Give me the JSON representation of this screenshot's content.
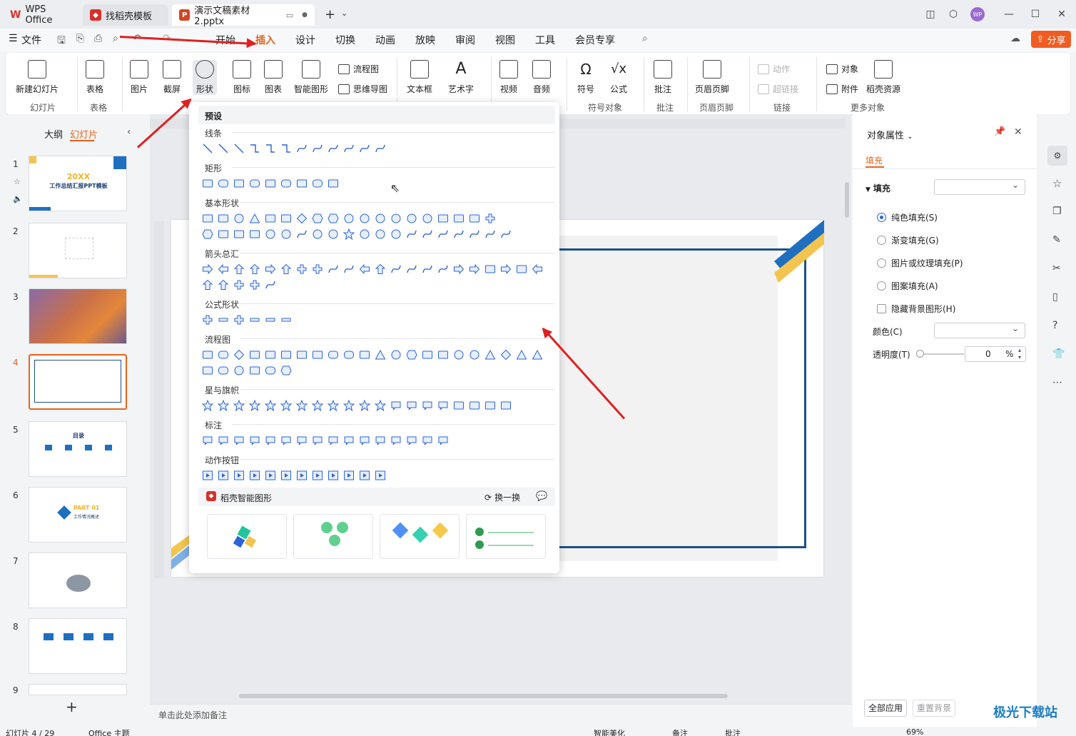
{
  "tabs": [
    {
      "label": "WPS Office",
      "icon": "wps-logo-icon",
      "color": "#d7302b"
    },
    {
      "label": "找稻壳模板",
      "icon": "docer-icon",
      "color": "#d7302b"
    },
    {
      "label": "演示文稿素材2.pptx",
      "icon": "ppt-icon",
      "color": "#d24726"
    }
  ],
  "user_avatar": "WP",
  "menu": {
    "file": "文件",
    "items": [
      "开始",
      "插入",
      "设计",
      "切换",
      "动画",
      "放映",
      "审阅",
      "视图",
      "工具",
      "会员专享"
    ],
    "active": "插入",
    "share": "分享"
  },
  "ribbon": {
    "new_slide": "新建幻灯片",
    "table": "表格",
    "picture": "图片",
    "screenshot": "截屏",
    "shape": "形状",
    "icon": "图标",
    "chart": "图表",
    "smartart": "智能图形",
    "flowchart": "流程图",
    "mindmap": "思维导图",
    "textbox": "文本框",
    "wordart": "艺术字",
    "video": "视频",
    "audio": "音频",
    "symbol": "符号",
    "formula": "公式",
    "comment": "批注",
    "header_footer": "页眉页脚",
    "action": "动作",
    "hyperlink": "超链接",
    "object": "对象",
    "attachment": "附件",
    "docer_res": "稻壳资源",
    "groups": {
      "slide": "幻灯片",
      "table": "表格",
      "symbol_obj": "符号对象",
      "comment": "批注",
      "header_footer": "页眉页脚",
      "link": "链接",
      "more": "更多对象"
    }
  },
  "left_panel": {
    "outline_tab": "大纲",
    "slides_tab": "幻灯片",
    "slide_numbers": [
      "1",
      "2",
      "3",
      "4",
      "5",
      "6",
      "7",
      "8",
      "9"
    ],
    "slide1_year": "20XX",
    "slide1_title": "工作总结汇报PPT模板",
    "slide5_title": "目录",
    "slide6_part": "PART 01",
    "slide6_title": "工作情况概述",
    "selected_slide": "4"
  },
  "shape_panel": {
    "preset": "预设",
    "sections": [
      "线条",
      "矩形",
      "基本形状",
      "箭头总汇",
      "公式形状",
      "流程图",
      "星与旗帜",
      "标注",
      "动作按钮"
    ],
    "docer_smart": "稻壳智能图形",
    "refresh": "换一换"
  },
  "notes_placeholder": "单击此处添加备注",
  "right_panel": {
    "title": "对象属性",
    "tab_fill": "填充",
    "fill_section": "填充",
    "options": [
      "纯色填充(S)",
      "渐变填充(G)",
      "图片或纹理填充(P)",
      "图案填充(A)"
    ],
    "selected_option": "纯色填充(S)",
    "hide_bg": "隐藏背景图形(H)",
    "color_label": "颜色(C)",
    "transparency_label": "透明度(T)",
    "transparency_value": "0",
    "transparency_unit": "%",
    "apply_all": "全部应用",
    "reset_bg": "重置背景"
  },
  "status": {
    "slide_info": "幻灯片 4 / 29",
    "theme": "Office 主题",
    "beautify": "智能美化",
    "notes": "备注",
    "comments": "批注",
    "zoom": "69%"
  },
  "watermark": "极光下载站",
  "colors": {
    "accent": "#e8631c",
    "brand_red": "#d7302b",
    "share": "#f05d23",
    "shape_blue": "#2b63d9"
  }
}
